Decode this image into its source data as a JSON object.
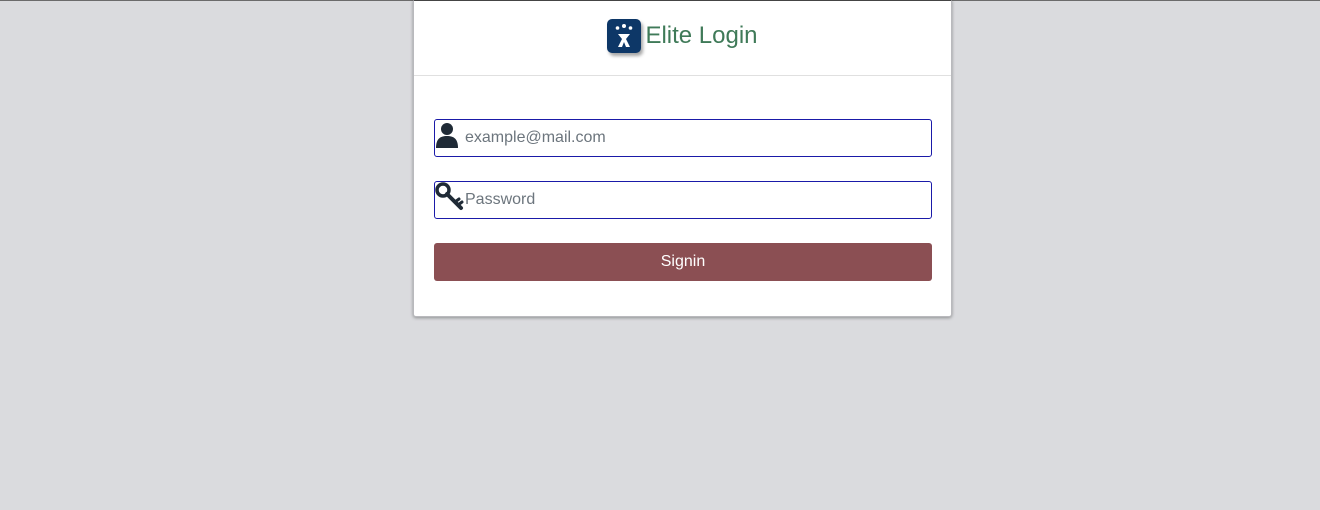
{
  "header": {
    "title": "Elite Login",
    "logo_icon": "atlassian-logo-icon",
    "title_color": "#3f7a58"
  },
  "form": {
    "email": {
      "placeholder": "example@mail.com",
      "value": "",
      "icon": "user-icon"
    },
    "password": {
      "placeholder": "Password",
      "value": "",
      "icon": "key-icon"
    },
    "submit_label": "Signin",
    "submit_color": "#8b4f53"
  },
  "colors": {
    "background": "#dadbde",
    "input_border": "#1a1aa8",
    "logo_bg": "#0d3767"
  }
}
